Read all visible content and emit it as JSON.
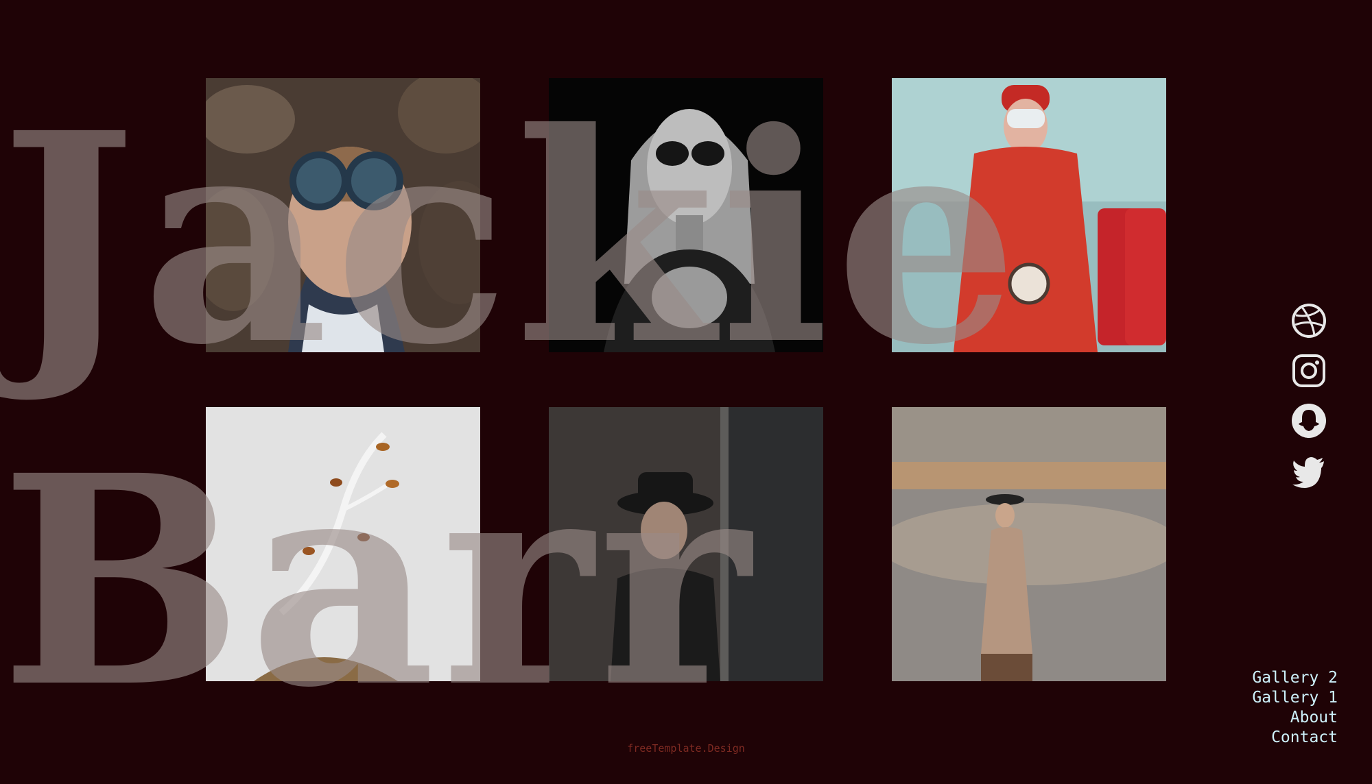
{
  "branding": {
    "first_name": "Jackie",
    "last_name": "Barr"
  },
  "gallery": {
    "images": [
      {
        "name": "woman-with-goggles-in-leaves",
        "icon": "portrait-photo-icon"
      },
      {
        "name": "woman-in-sunglasses-bw",
        "icon": "portrait-photo-icon"
      },
      {
        "name": "woman-in-red-with-clock",
        "icon": "portrait-photo-icon"
      },
      {
        "name": "branch-on-paper",
        "icon": "still-life-photo-icon"
      },
      {
        "name": "woman-in-black-hat-doorway",
        "icon": "portrait-photo-icon"
      },
      {
        "name": "woman-by-lake-in-hat",
        "icon": "portrait-photo-icon"
      }
    ]
  },
  "social": [
    {
      "name": "dribbble-icon"
    },
    {
      "name": "instagram-icon"
    },
    {
      "name": "snapchat-icon"
    },
    {
      "name": "twitter-icon"
    }
  ],
  "nav": {
    "items": [
      "Gallery 2",
      "Gallery 1",
      "About",
      "Contact"
    ]
  },
  "footer": {
    "text": "freeTemplate.Design"
  },
  "colors": {
    "background": "#1f0306",
    "nav_text": "#cdf1fb",
    "footer_text": "#7e2a22",
    "name_overlay": "#998a87"
  }
}
